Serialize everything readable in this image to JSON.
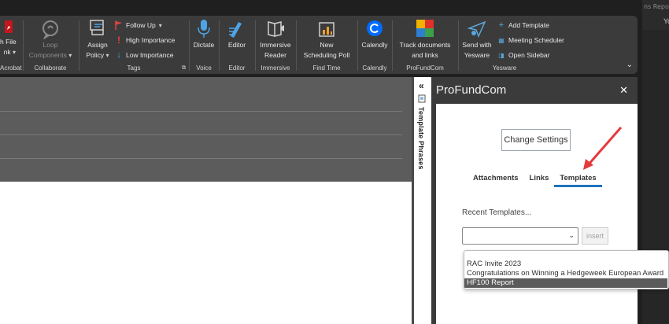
{
  "top_right": {
    "partial_text": "ns Repo",
    "partial_letter": "Yo"
  },
  "ribbon": {
    "acrobat": {
      "label_lines": [
        "h File",
        "nk"
      ],
      "group": "Acrobat"
    },
    "collaborate": {
      "button": [
        "Loop",
        "Components"
      ],
      "group": "Collaborate"
    },
    "tags": {
      "assign_policy": [
        "Assign",
        "Policy"
      ],
      "follow_up": "Follow Up",
      "high_importance": "High Importance",
      "low_importance": "Low Importance",
      "group": "Tags"
    },
    "voice": {
      "button": "Dictate",
      "group": "Voice"
    },
    "editor": {
      "button": "Editor",
      "group": "Editor"
    },
    "immersive": {
      "button": [
        "Immersive",
        "Reader"
      ],
      "group": "Immersive"
    },
    "find_time": {
      "button": [
        "New",
        "Scheduling Poll"
      ],
      "group": "Find Time"
    },
    "calendly": {
      "button": "Calendly",
      "group": "Calendly"
    },
    "profundcom": {
      "button": [
        "Track documents",
        "and links"
      ],
      "group": "ProFundCom"
    },
    "yesware": {
      "send_with": [
        "Send with",
        "Yesware"
      ],
      "add_template": "Add Template",
      "meeting_scheduler": "Meeting Scheduler",
      "open_sidebar": "Open Sidebar",
      "group": "Yesware"
    }
  },
  "template_strip": {
    "label": "Template Phrases"
  },
  "pane": {
    "title": "ProFundCom",
    "change_settings": "Change Settings",
    "tabs": [
      "Attachments",
      "Links",
      "Templates"
    ],
    "active_tab": "Templates",
    "recent_label": "Recent Templates...",
    "insert": "insert",
    "options": [
      "RAC Invite 2023",
      "Congratulations on Winning a Hedgeweek European Award",
      "HF100 Report"
    ],
    "selected_option": "HF100 Report"
  },
  "colors": {
    "accent": "#1e73be",
    "arrow": "#e5393b",
    "ribbon": "#3b3b3b"
  }
}
